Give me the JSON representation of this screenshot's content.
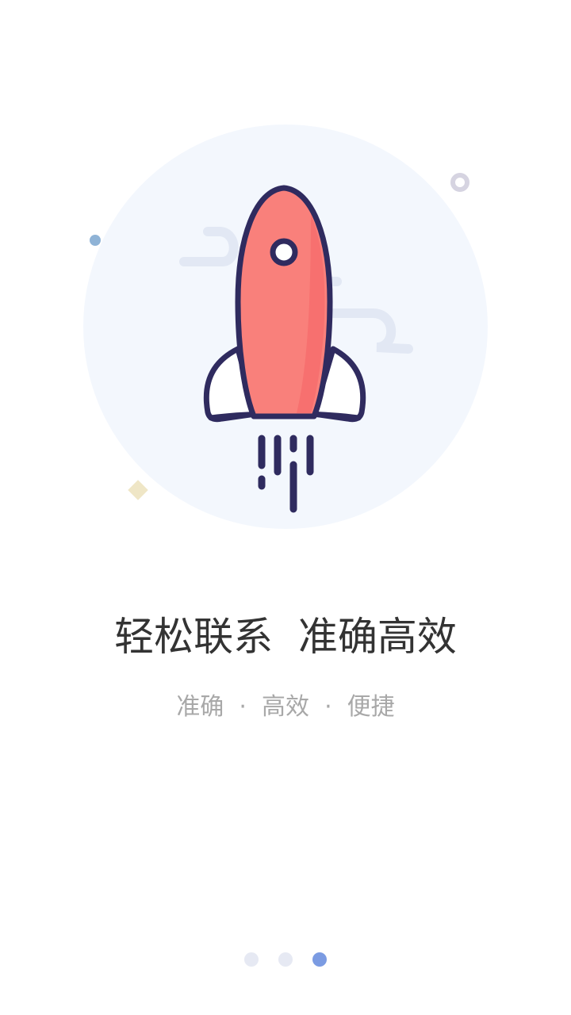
{
  "onboarding": {
    "title": "轻松联系  准确高效",
    "subtitle": "准确  ·  高效  ·  便捷",
    "illustration_icon": "rocket-icon"
  },
  "colors": {
    "circle_bg": "#f3f7fd",
    "rocket_body": "#f9807b",
    "rocket_outline": "#2f2b5f",
    "wing_fill": "#ffffff",
    "cloud": "#e2e8f4",
    "dot_inactive": "#e6e9f3",
    "dot_active": "#7b9be2",
    "title": "#333333",
    "subtitle": "#a8a8a8"
  },
  "pagination": {
    "total": 3,
    "active_index": 2
  }
}
